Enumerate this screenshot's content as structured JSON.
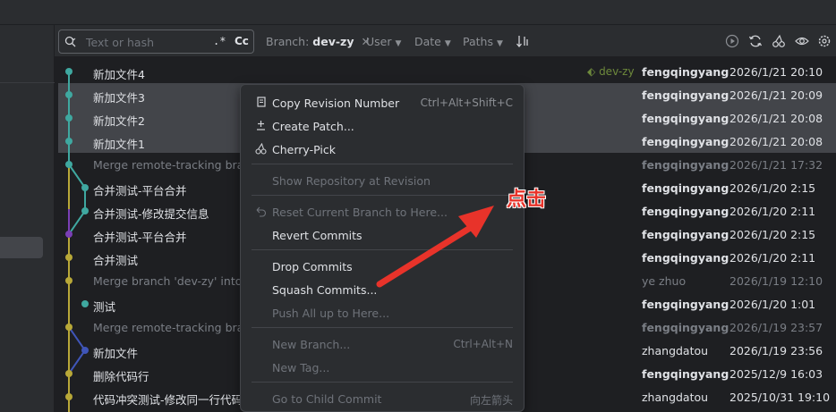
{
  "toolbar": {
    "search_placeholder": "Text or hash",
    "regex_label": ".*",
    "case_label": "Cc",
    "branch_filter_label": "Branch:",
    "branch_filter_value": "dev-zy",
    "branch_filter_clear": "✕",
    "user_filter": "User",
    "date_filter": "Date",
    "paths_filter": "Paths",
    "icons": [
      "search-icon",
      "sort-icon",
      "play-icon",
      "refresh-icon",
      "cherry-pick-icon",
      "eye-icon",
      "settings-icon"
    ]
  },
  "commits": [
    {
      "message": "新加文件4",
      "tag": "dev-zy",
      "author": "fengqingyang",
      "date": "2026/1/21 20:10",
      "selected": false,
      "dim": false
    },
    {
      "message": "新加文件3",
      "author": "fengqingyang",
      "date": "2026/1/21 20:09",
      "selected": true,
      "dim": false
    },
    {
      "message": "新加文件2",
      "author": "fengqingyang",
      "date": "2026/1/21 20:08",
      "selected": true,
      "dim": false
    },
    {
      "message": "新加文件1",
      "author": "fengqingyang",
      "date": "2026/1/21 20:08",
      "selected": true,
      "dim": false
    },
    {
      "message": "Merge remote-tracking bran",
      "author": "fengqingyang",
      "date": "2026/1/21 17:32",
      "selected": false,
      "dim": true
    },
    {
      "message": "合并测试-平台合并",
      "author": "fengqingyang",
      "date": "2026/1/20 2:15",
      "selected": false,
      "dim": false
    },
    {
      "message": "合并测试-修改提交信息",
      "author": "fengqingyang",
      "date": "2026/1/20 2:11",
      "selected": false,
      "dim": false
    },
    {
      "message": "合并测试-平台合并",
      "author": "fengqingyang",
      "date": "2026/1/20 2:15",
      "selected": false,
      "dim": false
    },
    {
      "message": "合并测试",
      "author": "fengqingyang",
      "date": "2026/1/20 2:11",
      "selected": false,
      "dim": false
    },
    {
      "message": "Merge branch 'dev-zy' into '",
      "author": "ye zhuo",
      "date": "2026/1/19 12:10",
      "selected": false,
      "dim": true
    },
    {
      "message": "测试",
      "author": "fengqingyang",
      "date": "2026/1/20 1:01",
      "selected": false,
      "dim": false
    },
    {
      "message": "Merge remote-tracking bran",
      "author": "fengqingyang",
      "date": "2026/1/19 23:57",
      "selected": false,
      "dim": true
    },
    {
      "message": "新加文件",
      "author": "zhangdatou",
      "date": "2026/1/19 23:56",
      "selected": false,
      "dim": false
    },
    {
      "message": "删除代码行",
      "author": "fengqingyang",
      "date": "2025/12/9 16:03",
      "selected": false,
      "dim": false
    },
    {
      "message": "代码冲突测试-修改同一行代码",
      "author": "zhangdatou",
      "date": "2025/10/31 19:10",
      "selected": false,
      "dim": false
    }
  ],
  "context_menu": {
    "items": [
      {
        "label": "Copy Revision Number",
        "shortcut": "Ctrl+Alt+Shift+C",
        "icon": "copy-icon",
        "disabled": false
      },
      {
        "label": "Create Patch...",
        "shortcut": "",
        "icon": "patch-icon",
        "disabled": false
      },
      {
        "label": "Cherry-Pick",
        "shortcut": "",
        "icon": "cherry-icon",
        "disabled": false
      },
      {
        "label": "Show Repository at Revision",
        "shortcut": "",
        "icon": "",
        "disabled": true
      },
      {
        "label": "Reset Current Branch to Here...",
        "shortcut": "",
        "icon": "undo-icon",
        "disabled": true
      },
      {
        "label": "Revert Commits",
        "shortcut": "",
        "icon": "",
        "disabled": false
      },
      {
        "label": "Drop Commits",
        "shortcut": "",
        "icon": "",
        "disabled": false
      },
      {
        "label": "Squash Commits...",
        "shortcut": "",
        "icon": "",
        "disabled": false
      },
      {
        "label": "Push All up to Here...",
        "shortcut": "",
        "icon": "",
        "disabled": true
      },
      {
        "label": "New Branch...",
        "shortcut": "Ctrl+Alt+N",
        "icon": "",
        "disabled": true
      },
      {
        "label": "New Tag...",
        "shortcut": "",
        "icon": "",
        "disabled": true
      },
      {
        "label": "Go to Child Commit",
        "shortcut": "向左箭头",
        "icon": "",
        "disabled": true
      }
    ]
  },
  "annotation": {
    "text": "点击",
    "color": "#e8332a"
  },
  "graph_colors": [
    "#3fa8a0",
    "#7a3fb5",
    "#b8a838",
    "#3f55b8"
  ]
}
